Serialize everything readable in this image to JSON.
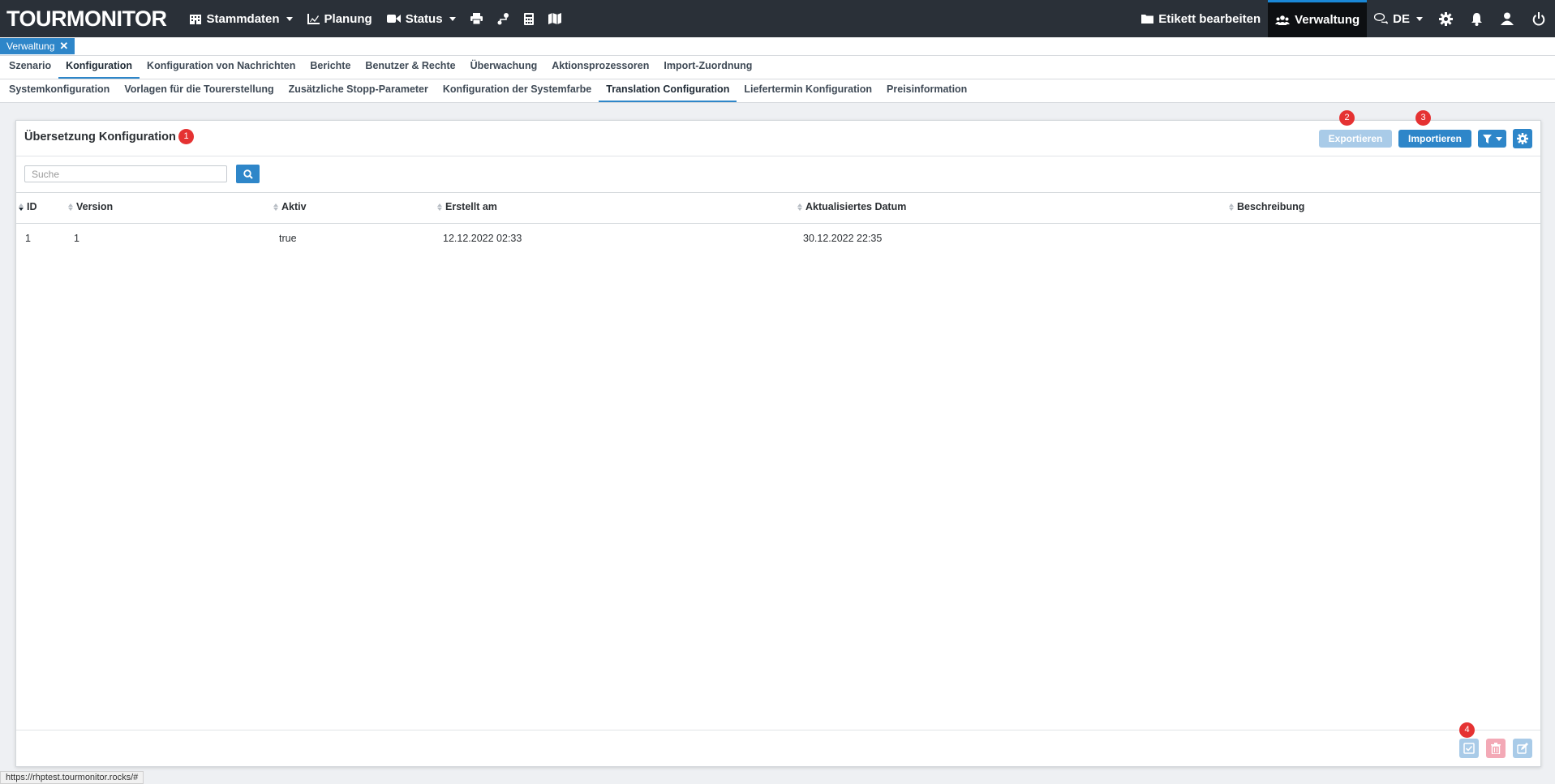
{
  "navbar": {
    "brand": "TOURMONITOR",
    "items": [
      {
        "label": "Stammdaten",
        "icon": "building-icon"
      },
      {
        "label": "Planung",
        "icon": "chart-icon"
      },
      {
        "label": "Status",
        "icon": "video-icon"
      }
    ],
    "icon_buttons": [
      "print-icon",
      "route-icon",
      "calculator-icon",
      "map-icon"
    ],
    "right": {
      "edit_label": "Etikett bearbeiten",
      "admin_label": "Verwaltung",
      "language": "DE"
    }
  },
  "doc_tab": {
    "label": "Verwaltung",
    "close": "✕"
  },
  "menu1": {
    "items": [
      "Szenario",
      "Konfiguration",
      "Konfiguration von Nachrichten",
      "Berichte",
      "Benutzer & Rechte",
      "Überwachung",
      "Aktionsprozessoren",
      "Import-Zuordnung"
    ],
    "active": "Konfiguration"
  },
  "menu2": {
    "items": [
      "Systemkonfiguration",
      "Vorlagen für die Tourerstellung",
      "Zusätzliche Stopp-Parameter",
      "Konfiguration der Systemfarbe",
      "Translation Configuration",
      "Liefertermin Konfiguration",
      "Preisinformation"
    ],
    "active": "Translation Configuration"
  },
  "panel": {
    "title": "Übersetzung Konfiguration",
    "badges": [
      "1",
      "2",
      "3",
      "4"
    ],
    "export_label": "Exportieren",
    "import_label": "Importieren",
    "search_placeholder": "Suche"
  },
  "table": {
    "columns": [
      "ID",
      "Version",
      "Aktiv",
      "Erstellt am",
      "Aktualisiertes Datum",
      "Beschreibung"
    ],
    "rows": [
      {
        "id": "1",
        "version": "1",
        "aktiv": "true",
        "erstellt": "12.12.2022 02:33",
        "aktualisiert": "30.12.2022 22:35",
        "beschreibung": ""
      }
    ]
  },
  "statusbar": {
    "url": "https://rhptest.tourmonitor.rocks/#"
  },
  "colors": {
    "navbar": "#2a3038",
    "primary": "#2e86c9",
    "badge": "#e53232"
  }
}
